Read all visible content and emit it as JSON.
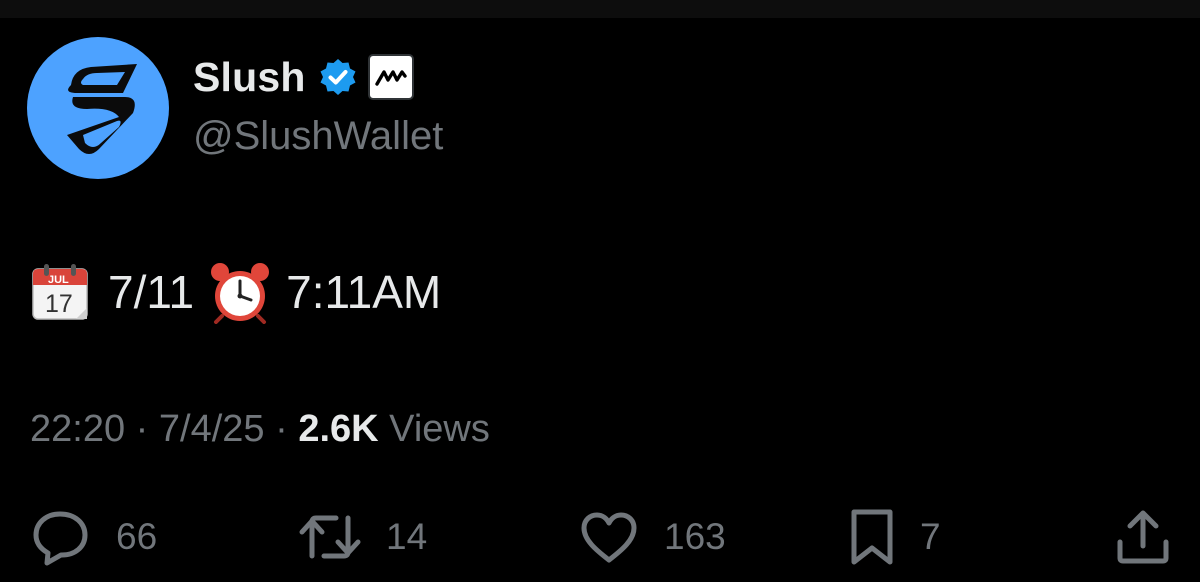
{
  "profile": {
    "display_name": "Slush",
    "handle": "@SlushWallet",
    "avatar_color": "#4da2ff",
    "verified_color": "#1d9bf0",
    "avatar_icon": "slush-logo-icon",
    "verified_icon": "verified-badge-icon",
    "affiliate_icon": "mysten-affiliate-icon"
  },
  "tweet": {
    "date_text": "7/11",
    "time_text": "7:11AM",
    "calendar_icon": "calendar-icon",
    "calendar_month": "JUL",
    "calendar_day": "17",
    "clock_icon": "alarm-clock-icon"
  },
  "meta": {
    "time": "22:20",
    "separator": " · ",
    "date": "7/4/25",
    "views_count": "2.6K",
    "views_label": "Views"
  },
  "actions": {
    "reply": {
      "icon": "reply-icon",
      "count": "66"
    },
    "repost": {
      "icon": "repost-icon",
      "count": "14"
    },
    "like": {
      "icon": "heart-icon",
      "count": "163"
    },
    "bookmark": {
      "icon": "bookmark-icon",
      "count": "7"
    },
    "share": {
      "icon": "share-icon"
    }
  }
}
